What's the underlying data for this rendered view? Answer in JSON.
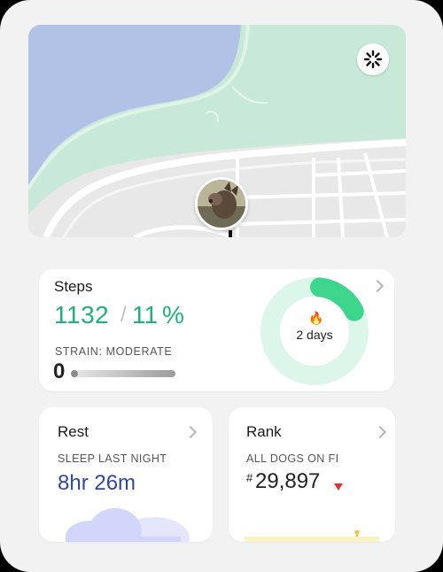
{
  "steps_card": {
    "title": "Steps",
    "count": "1132",
    "slash": "/",
    "percent": "11",
    "percent_sign": "%",
    "strain_label": "STRAIN: MODERATE",
    "strain_value": "0",
    "strain_level": 0,
    "goal_progress": 0.11,
    "streak": "2 days",
    "streak_icon": "flame-icon",
    "colors": {
      "accent": "#22b07a",
      "ring_track": "#dcf7ea",
      "ring_fill": "#3dd68c"
    }
  },
  "rest_card": {
    "title": "Rest",
    "sleep_label": "SLEEP LAST NIGHT",
    "sleep_value": "8hr 26m",
    "color": "#3047a8"
  },
  "rank_card": {
    "title": "Rank",
    "scope_label": "ALL DOGS ON FI",
    "hash": "#",
    "rank_value": "29,897",
    "trend": "down",
    "trend_color": "#d63a2f"
  },
  "map": {
    "action_icon": "sparkle-icon",
    "avatar": "dog-avatar"
  }
}
